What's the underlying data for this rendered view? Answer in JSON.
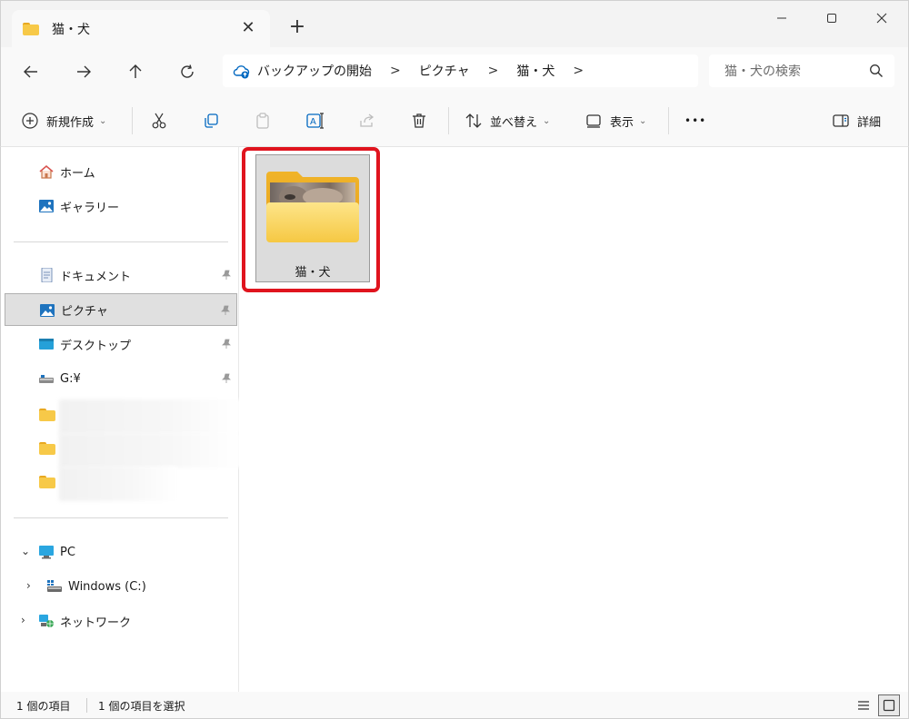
{
  "window": {
    "tab_title": "猫・犬",
    "tab_close_glyph": "✕",
    "new_tab_glyph": "+"
  },
  "address": {
    "crumbs": [
      "バックアップの開始",
      "ピクチャ",
      "猫・犬"
    ],
    "separator": ">",
    "search_placeholder": "猫・犬の検索"
  },
  "commands": {
    "new_label": "新規作成",
    "sort_label": "並べ替え",
    "view_label": "表示",
    "more_glyph": "•••",
    "details_label": "詳細",
    "chevron": "⌄"
  },
  "sidebar": {
    "quick": [
      {
        "label": "ホーム",
        "icon": "home-icon"
      },
      {
        "label": "ギャラリー",
        "icon": "gallery-icon"
      }
    ],
    "pinned": [
      {
        "label": "ドキュメント",
        "icon": "document-icon"
      },
      {
        "label": "ピクチャ",
        "icon": "pictures-icon",
        "selected": true
      },
      {
        "label": "デスクトップ",
        "icon": "desktop-icon"
      },
      {
        "label": "G:¥",
        "icon": "drive-icon"
      }
    ],
    "tree": [
      {
        "label": "PC",
        "icon": "pc-icon",
        "expander": "⌄"
      },
      {
        "label": "Windows (C:)",
        "icon": "windows-drive-icon",
        "expander": "›"
      },
      {
        "label": "ネットワーク",
        "icon": "network-icon",
        "expander": "›"
      }
    ]
  },
  "content": {
    "items": [
      {
        "name": "猫・犬",
        "type": "folder",
        "selected": true
      }
    ]
  },
  "status": {
    "item_count": "1 個の項目",
    "selection": "1 個の項目を選択"
  },
  "colors": {
    "highlight": "#e0141e",
    "folder": "#f7c948",
    "accent": "#0067c0"
  }
}
